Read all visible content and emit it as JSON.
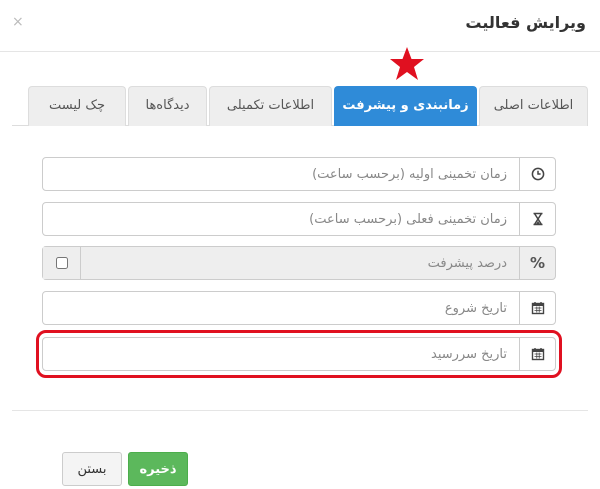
{
  "modal": {
    "title": "ویرایش فعالیت",
    "close_symbol": "×"
  },
  "tabs": [
    {
      "label": "اطلاعات اصلی",
      "active": false
    },
    {
      "label": "زمانبندی و پیشرفت",
      "active": true
    },
    {
      "label": "اطلاعات تکمیلی",
      "active": false
    },
    {
      "label": "دیدگاه‌ها",
      "active": false
    },
    {
      "label": "چک لیست",
      "active": false
    }
  ],
  "fields": {
    "initial_estimate": {
      "placeholder": "زمان تخمینی اولیه (برحسب ساعت)",
      "value": "",
      "icon": "clock-icon"
    },
    "current_estimate": {
      "placeholder": "زمان تخمینی فعلی (برحسب ساعت)",
      "value": "",
      "icon": "hourglass-icon"
    },
    "progress": {
      "placeholder": "درصد پیشرفت",
      "value": "",
      "icon": "percent-icon",
      "symbol": "%",
      "checked": false
    },
    "start_date": {
      "placeholder": "تاریخ شروع",
      "value": "",
      "icon": "calendar-icon"
    },
    "due_date": {
      "placeholder": "تاریخ سررسید",
      "value": "",
      "icon": "calendar-icon"
    }
  },
  "buttons": {
    "save": "ذخیره",
    "close": "بستن"
  },
  "colors": {
    "active_tab": "#2f8bd8",
    "save_button": "#5cb85c",
    "highlight": "#e01020",
    "star": "#e01020"
  }
}
